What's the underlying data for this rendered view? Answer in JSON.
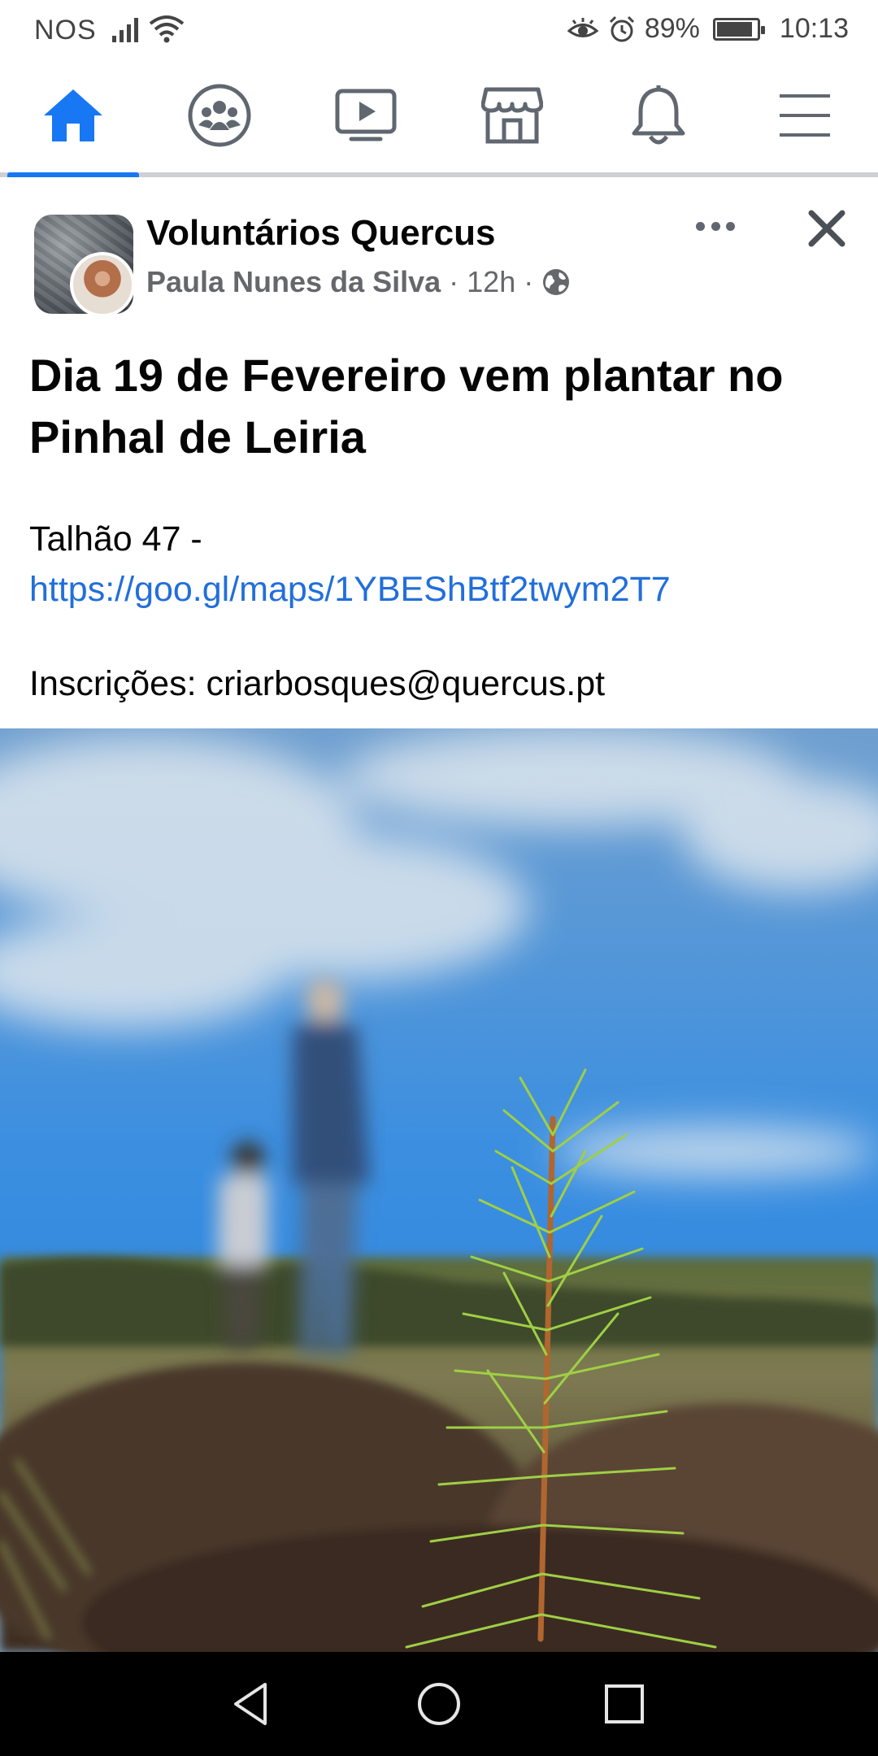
{
  "status_bar": {
    "carrier": "NOS",
    "battery": "89%",
    "battery_level": 0.89,
    "time": "10:13"
  },
  "nav": {
    "items": [
      {
        "icon": "home-icon",
        "active": true
      },
      {
        "icon": "groups-icon",
        "active": false
      },
      {
        "icon": "watch-icon",
        "active": false
      },
      {
        "icon": "marketplace-icon",
        "active": false
      },
      {
        "icon": "notifications-icon",
        "active": false
      },
      {
        "icon": "menu-icon",
        "active": false
      }
    ],
    "accent_color": "#1877f2"
  },
  "post": {
    "group_name": "Voluntários Quercus",
    "author": "Paula Nunes da Silva",
    "separator": "·",
    "time": "12h",
    "privacy_icon": "globe-icon",
    "title": "Dia 19 de Fevereiro vem plantar no Pinhal de Leiria",
    "body_prefix": "Talhão 47 -",
    "link": "https://goo.gl/maps/1YBEShBtf2twym2T7",
    "contact": "Inscrições: criarbosques@quercus.pt",
    "link_color": "#216fdb"
  },
  "system_nav": {
    "back_icon": "back-icon",
    "home_icon": "circle-home-icon",
    "recents_icon": "recents-icon"
  }
}
